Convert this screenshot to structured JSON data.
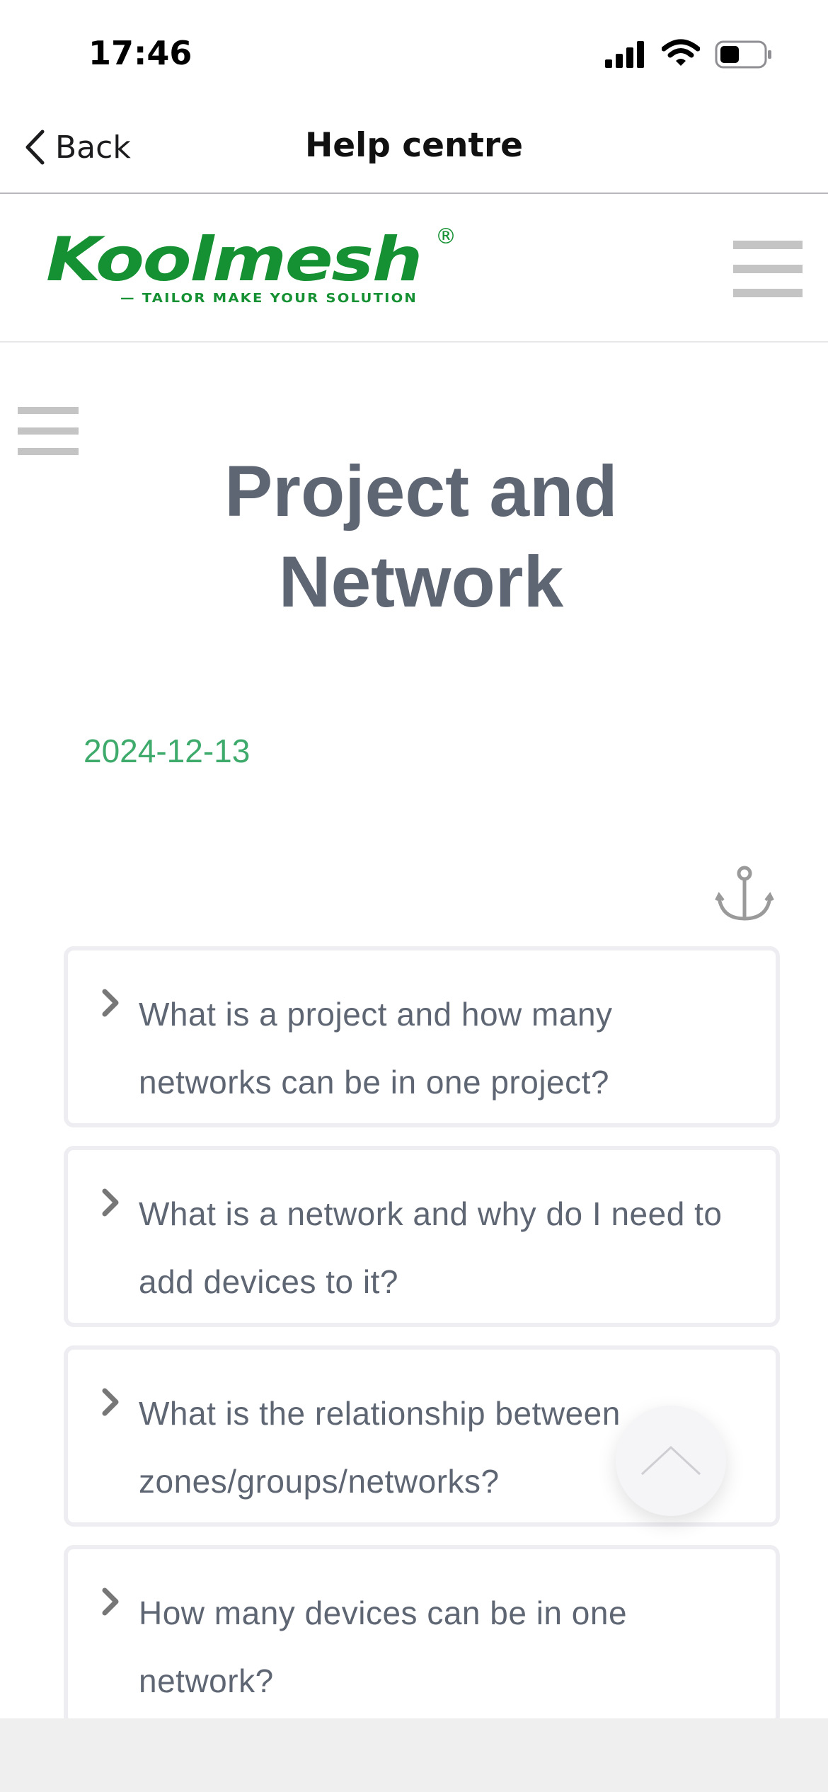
{
  "status_bar": {
    "time": "17:46",
    "icons": [
      "signal-icon",
      "wifi-icon",
      "battery-icon"
    ]
  },
  "nav_bar": {
    "back_label": "Back",
    "title": "Help centre"
  },
  "header": {
    "logo_text": "Koolmesh",
    "logo_tagline": "— TAILOR MAKE YOUR SOLUTION",
    "logo_registered_mark": "®"
  },
  "article": {
    "title": "Project and Network",
    "date": "2024-12-13"
  },
  "faq": {
    "items": [
      {
        "question": "What is a project and how many networks can be in one project?"
      },
      {
        "question": "What is a network and why do I need to add devices to it?"
      },
      {
        "question": "What is the relationship between zones/groups/networks?"
      },
      {
        "question": "How many devices can be in one network?"
      }
    ]
  },
  "colors": {
    "title_text": "#5f6673",
    "date_green": "#3eaa6b",
    "logo_green": "#159133",
    "menu_gray": "#c4c4c4",
    "card_border": "#eeeef2"
  }
}
